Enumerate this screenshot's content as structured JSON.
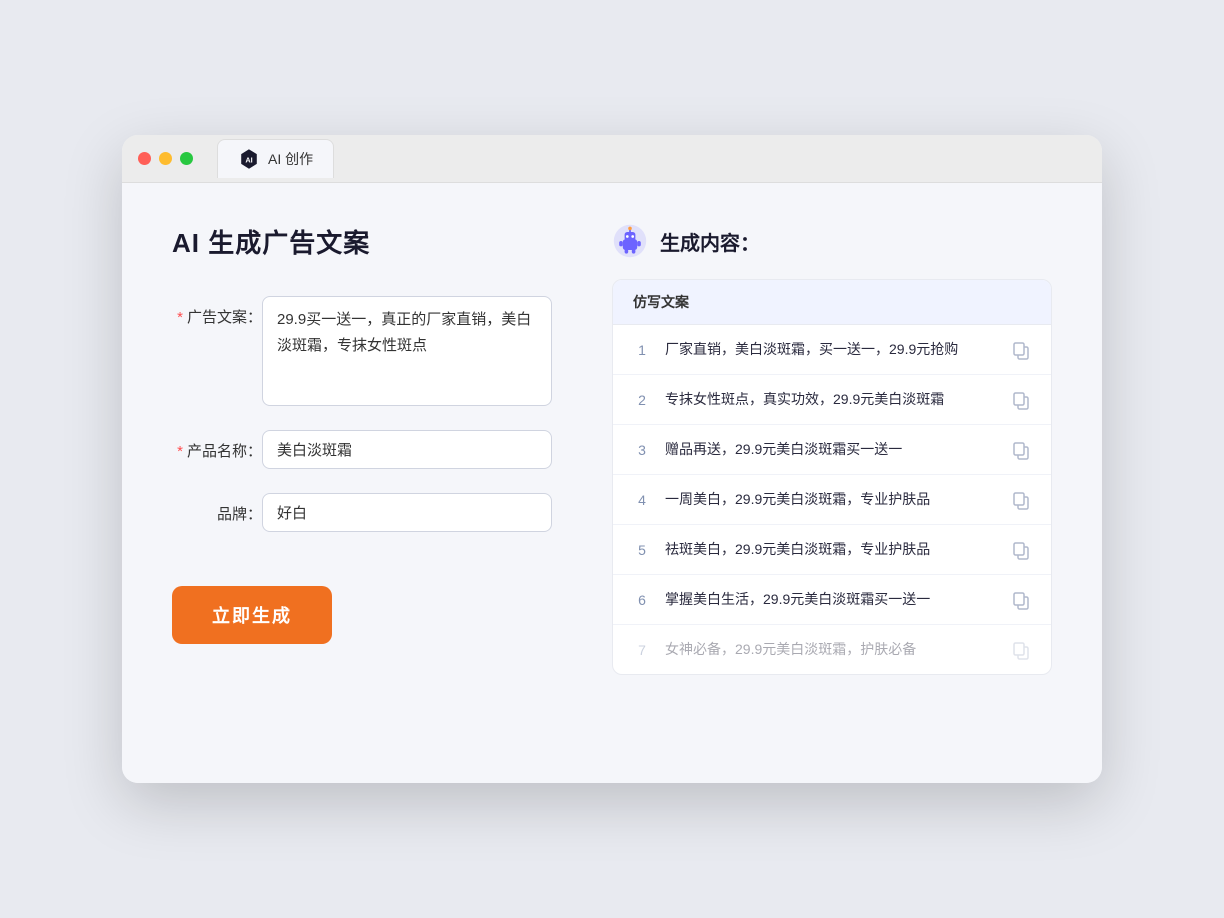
{
  "browser": {
    "tab_label": "AI 创作"
  },
  "page": {
    "title": "AI 生成广告文案",
    "result_title": "生成内容："
  },
  "form": {
    "ad_copy_label": "广告文案：",
    "ad_copy_value": "29.9买一送一，真正的厂家直销，美白淡斑霜，专抹女性斑点",
    "product_name_label": "产品名称：",
    "product_name_value": "美白淡斑霜",
    "brand_label": "品牌：",
    "brand_value": "好白",
    "generate_button": "立即生成"
  },
  "results": {
    "column_header": "仿写文案",
    "items": [
      {
        "id": 1,
        "text": "厂家直销，美白淡斑霜，买一送一，29.9元抢购"
      },
      {
        "id": 2,
        "text": "专抹女性斑点，真实功效，29.9元美白淡斑霜"
      },
      {
        "id": 3,
        "text": "赠品再送，29.9元美白淡斑霜买一送一"
      },
      {
        "id": 4,
        "text": "一周美白，29.9元美白淡斑霜，专业护肤品"
      },
      {
        "id": 5,
        "text": "祛斑美白，29.9元美白淡斑霜，专业护肤品"
      },
      {
        "id": 6,
        "text": "掌握美白生活，29.9元美白淡斑霜买一送一"
      },
      {
        "id": 7,
        "text": "女神必备，29.9元美白淡斑霜，护肤必备",
        "faded": true
      }
    ]
  }
}
